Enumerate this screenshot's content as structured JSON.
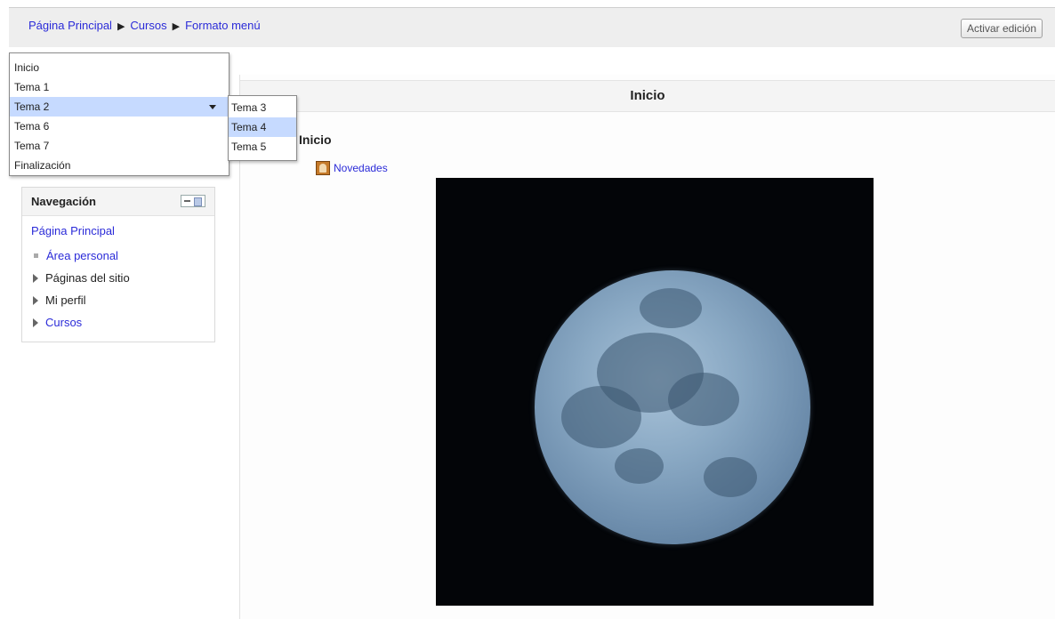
{
  "breadcrumb": {
    "home": "Página Principal",
    "separator1": "▶",
    "courses": "Cursos",
    "separator2": "▶",
    "current": "Formato menú"
  },
  "header": {
    "edit_button": "Activar edición"
  },
  "menu": {
    "items": [
      "Inicio",
      "Tema 1",
      "Tema 2",
      "Tema 6",
      "Tema 7",
      "Finalización"
    ],
    "active": "Tema 2",
    "submenu": [
      "Tema 3",
      "Tema 4",
      "Tema 5"
    ],
    "submenu_hover": "Tema 4"
  },
  "section": {
    "header_title": "Inicio",
    "name": "Inicio",
    "activity_label": "Novedades",
    "activity_icon": "forum-icon"
  },
  "navigation": {
    "title": "Navegación",
    "home": "Página Principal",
    "items": [
      "Área personal",
      "Páginas del sitio",
      "Mi perfil",
      "Cursos"
    ]
  },
  "image": {
    "subject": "full moon",
    "background_color": "#030508",
    "moon_color": "#8aa9c4"
  },
  "colors": {
    "link": "#2b2bd8",
    "menu_active": "#c6daff",
    "navbar_bg": "#eeeeee"
  }
}
